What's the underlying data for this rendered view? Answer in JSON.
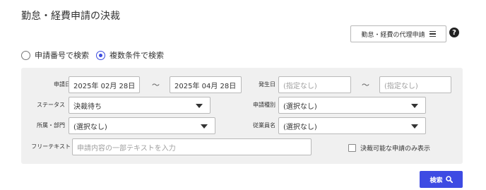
{
  "page": {
    "title": "勤怠・経費申請の決裁",
    "proxy_button_label": "勤怠・経費の代理申請",
    "help_symbol": "?"
  },
  "search_mode": {
    "options": [
      {
        "label": "申請番号で検索",
        "checked": false
      },
      {
        "label": "複数条件で検索",
        "checked": true
      }
    ]
  },
  "filters": {
    "application_date": {
      "label": "申請日",
      "from": "2025年 02月 28日",
      "to": "2025年 04月 28日"
    },
    "occurrence_date": {
      "label": "発生日",
      "from_placeholder": "(指定なし)",
      "to_placeholder": "(指定なし)"
    },
    "range_separator": "～",
    "status": {
      "label": "ステータス",
      "value": "決裁待ち"
    },
    "application_type": {
      "label": "申請種別",
      "value": "(選択なし)"
    },
    "department": {
      "label": "所属・部門",
      "value": "(選択なし)"
    },
    "employee_name": {
      "label": "従業員名",
      "value": "(選択なし)"
    },
    "free_text": {
      "label": "フリーテキスト",
      "placeholder": "申請内容の一部テキストを入力"
    },
    "approvable_only": {
      "label": "決裁可能な申請のみ表示",
      "checked": false
    }
  },
  "search_button": {
    "label": "検索"
  },
  "colors": {
    "accent": "#3d4be3",
    "panel_bg": "#f0f0f0"
  }
}
